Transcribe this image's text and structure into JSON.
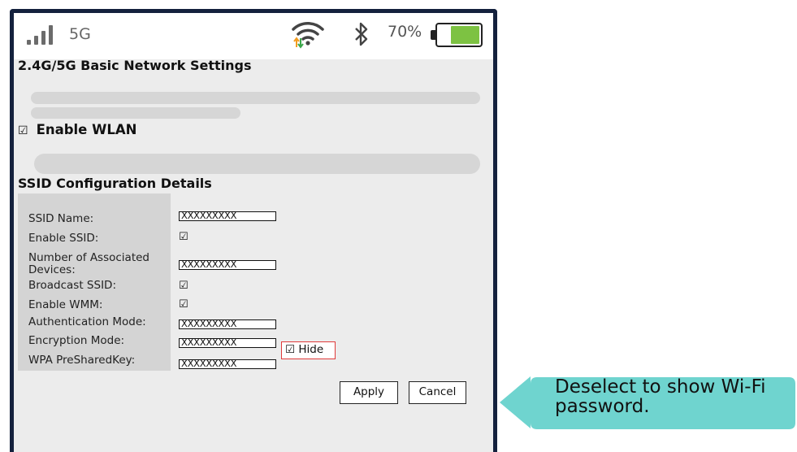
{
  "statusbar": {
    "network": "5G",
    "battery_percent": "70%",
    "battery_level": 0.7,
    "icons": [
      "signal-icon",
      "wifi-icon",
      "bluetooth-icon",
      "battery-icon"
    ]
  },
  "page_title": "2.4G/5G Basic Network Settings",
  "wlan": {
    "checkbox": "☑",
    "label": "Enable WLAN"
  },
  "section_title": "SSID Configuration Details",
  "fields": {
    "ssid_name": {
      "label": "SSID Name:",
      "value": "XXXXXXXXX"
    },
    "enable_ssid": {
      "label": "Enable SSID:",
      "checked": "☑"
    },
    "associated_devices": {
      "label_line1": "Number of Associated",
      "label_line2": "Devices:",
      "value": "XXXXXXXXX"
    },
    "broadcast_ssid": {
      "label": "Broadcast SSID:",
      "checked": "☑"
    },
    "enable_wmm": {
      "label": "Enable WMM:",
      "checked": "☑"
    },
    "auth_mode": {
      "label": "Authentication Mode:",
      "value": "XXXXXXXXX"
    },
    "encryption_mode": {
      "label": "Encryption Mode:",
      "value": "XXXXXXXXX"
    },
    "wpa_key": {
      "label": "WPA PreSharedKey:",
      "value": "XXXXXXXXX"
    }
  },
  "hide": {
    "checkbox": "☑",
    "label": "Hide"
  },
  "buttons": {
    "apply": "Apply",
    "cancel": "Cancel"
  },
  "callout": {
    "text": "Deselect to show Wi-Fi password.",
    "color": "#6fd4cf"
  },
  "colors": {
    "device_border": "#14213d",
    "battery_fill": "#7dc242",
    "highlight": "#e03a3a"
  }
}
